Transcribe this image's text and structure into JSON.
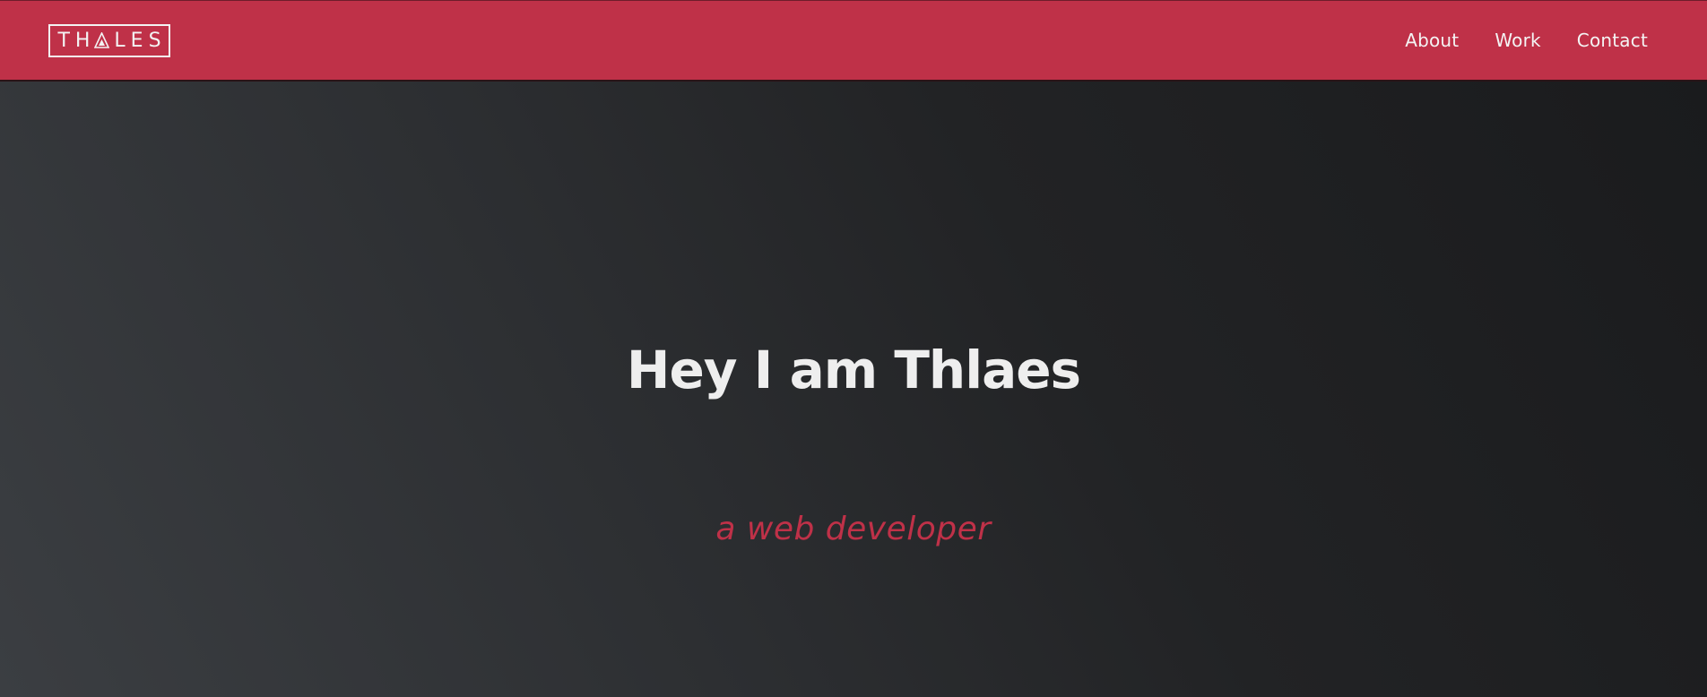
{
  "brand": {
    "logo_prefix": "TH",
    "logo_suffix": "LES",
    "logo_icon": "triangle-a-icon"
  },
  "nav": {
    "items": [
      {
        "label": "About"
      },
      {
        "label": "Work"
      },
      {
        "label": "Contact"
      }
    ]
  },
  "hero": {
    "title": "Hey I am Thlaes",
    "subtitle": "a web developer"
  },
  "colors": {
    "accent": "#bf3148",
    "hero_bg_dark": "#1a1b1d",
    "hero_bg_light": "#3b3e42",
    "text_light": "#eeeeee"
  }
}
